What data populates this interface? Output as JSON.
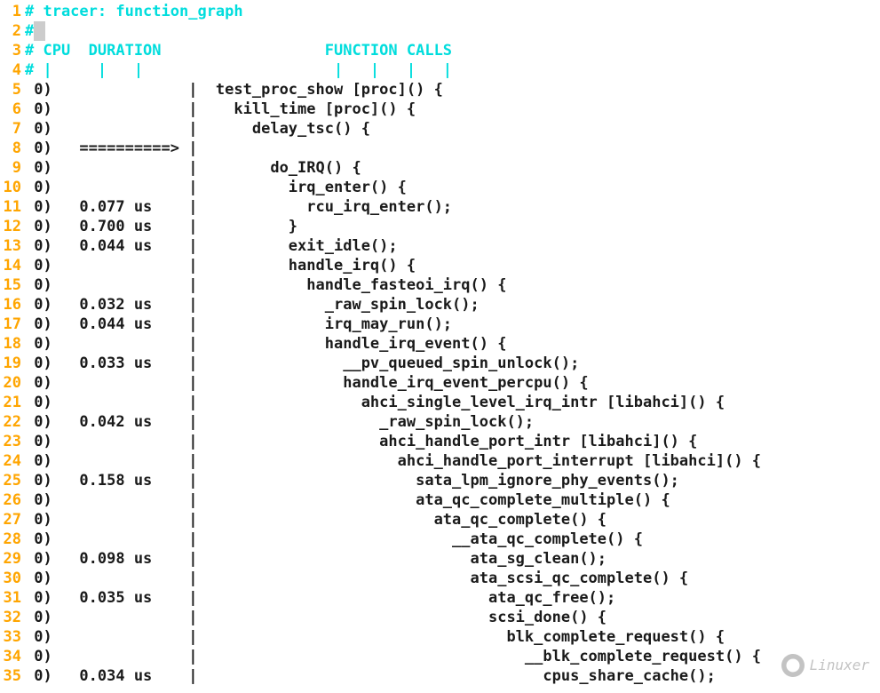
{
  "watermark": "Linuxer",
  "lines": [
    {
      "n": 1,
      "type": "comment",
      "text": "# tracer: function_graph"
    },
    {
      "n": 2,
      "type": "comment-cursor",
      "prefix": "#",
      "cursor": " "
    },
    {
      "n": 3,
      "type": "comment",
      "text": "# CPU  DURATION                  FUNCTION CALLS"
    },
    {
      "n": 4,
      "type": "comment",
      "text": "# |     |   |                     |   |   |   |"
    },
    {
      "n": 5,
      "type": "code",
      "text": " 0)               |  test_proc_show [proc]() {"
    },
    {
      "n": 6,
      "type": "code",
      "text": " 0)               |    kill_time [proc]() {"
    },
    {
      "n": 7,
      "type": "code",
      "text": " 0)               |      delay_tsc() {"
    },
    {
      "n": 8,
      "type": "code",
      "text": " 0)   ==========> |"
    },
    {
      "n": 9,
      "type": "code",
      "text": " 0)               |        do_IRQ() {"
    },
    {
      "n": 10,
      "type": "code",
      "text": " 0)               |          irq_enter() {"
    },
    {
      "n": 11,
      "type": "code",
      "text": " 0)   0.077 us    |            rcu_irq_enter();"
    },
    {
      "n": 12,
      "type": "code",
      "text": " 0)   0.700 us    |          }"
    },
    {
      "n": 13,
      "type": "code",
      "text": " 0)   0.044 us    |          exit_idle();"
    },
    {
      "n": 14,
      "type": "code",
      "text": " 0)               |          handle_irq() {"
    },
    {
      "n": 15,
      "type": "code",
      "text": " 0)               |            handle_fasteoi_irq() {"
    },
    {
      "n": 16,
      "type": "code",
      "text": " 0)   0.032 us    |              _raw_spin_lock();"
    },
    {
      "n": 17,
      "type": "code",
      "text": " 0)   0.044 us    |              irq_may_run();"
    },
    {
      "n": 18,
      "type": "code",
      "text": " 0)               |              handle_irq_event() {"
    },
    {
      "n": 19,
      "type": "code",
      "text": " 0)   0.033 us    |                __pv_queued_spin_unlock();"
    },
    {
      "n": 20,
      "type": "code",
      "text": " 0)               |                handle_irq_event_percpu() {"
    },
    {
      "n": 21,
      "type": "code",
      "text": " 0)               |                  ahci_single_level_irq_intr [libahci]() {"
    },
    {
      "n": 22,
      "type": "code",
      "text": " 0)   0.042 us    |                    _raw_spin_lock();"
    },
    {
      "n": 23,
      "type": "code",
      "text": " 0)               |                    ahci_handle_port_intr [libahci]() {"
    },
    {
      "n": 24,
      "type": "code",
      "text": " 0)               |                      ahci_handle_port_interrupt [libahci]() {"
    },
    {
      "n": 25,
      "type": "code",
      "text": " 0)   0.158 us    |                        sata_lpm_ignore_phy_events();"
    },
    {
      "n": 26,
      "type": "code",
      "text": " 0)               |                        ata_qc_complete_multiple() {"
    },
    {
      "n": 27,
      "type": "code",
      "text": " 0)               |                          ata_qc_complete() {"
    },
    {
      "n": 28,
      "type": "code",
      "text": " 0)               |                            __ata_qc_complete() {"
    },
    {
      "n": 29,
      "type": "code",
      "text": " 0)   0.098 us    |                              ata_sg_clean();"
    },
    {
      "n": 30,
      "type": "code",
      "text": " 0)               |                              ata_scsi_qc_complete() {"
    },
    {
      "n": 31,
      "type": "code",
      "text": " 0)   0.035 us    |                                ata_qc_free();"
    },
    {
      "n": 32,
      "type": "code",
      "text": " 0)               |                                scsi_done() {"
    },
    {
      "n": 33,
      "type": "code",
      "text": " 0)               |                                  blk_complete_request() {"
    },
    {
      "n": 34,
      "type": "code",
      "text": " 0)               |                                    __blk_complete_request() {"
    },
    {
      "n": 35,
      "type": "code",
      "text": " 0)   0.034 us    |                                      cpus_share_cache();"
    }
  ]
}
